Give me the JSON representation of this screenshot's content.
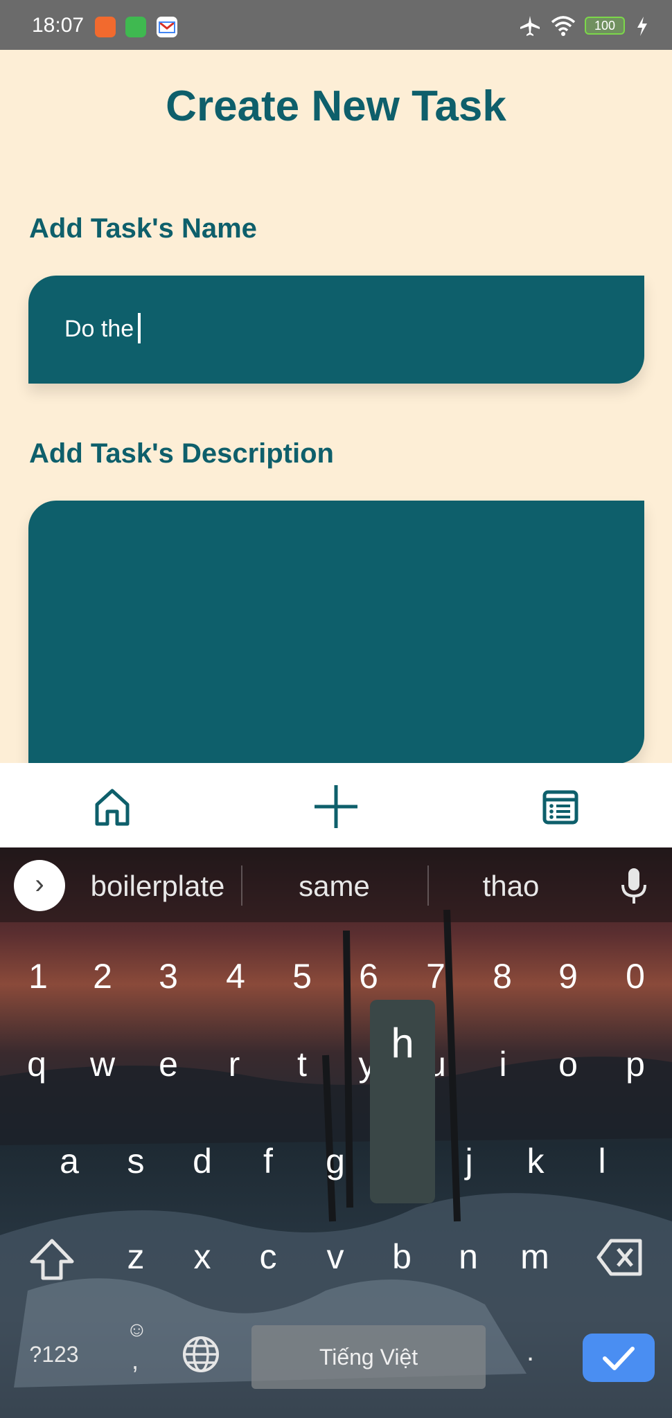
{
  "status_bar": {
    "time": "18:07",
    "battery": "100",
    "icons": [
      "video-app-icon",
      "chat-app-icon",
      "gmail-icon",
      "airplane-mode-icon",
      "wifi-icon",
      "battery-icon",
      "charging-icon"
    ]
  },
  "screen": {
    "title": "Create New Task",
    "name_label": "Add Task's Name",
    "name_value": "Do the",
    "description_label": "Add Task's Description",
    "description_value": ""
  },
  "bottom_nav": {
    "items": [
      "home-icon",
      "add-icon",
      "task-list-icon"
    ]
  },
  "keyboard": {
    "suggestions": [
      "boilerplate",
      "same",
      "thao"
    ],
    "number_row": [
      "1",
      "2",
      "3",
      "4",
      "5",
      "6",
      "7",
      "8",
      "9",
      "0"
    ],
    "row1": [
      "q",
      "w",
      "e",
      "r",
      "t",
      "y",
      "u",
      "i",
      "o",
      "p"
    ],
    "row2": [
      "a",
      "s",
      "d",
      "f",
      "g",
      "h",
      "j",
      "k",
      "l"
    ],
    "row3": [
      "z",
      "x",
      "c",
      "v",
      "b",
      "n",
      "m"
    ],
    "pressed_key": "h",
    "symbols_label": "?123",
    "emoji_label": "☺",
    "comma_label": ",",
    "space_label": "Tiếng Việt",
    "period_label": "."
  },
  "colors": {
    "background": "#fdeed6",
    "primary": "#0e5f6b",
    "enter_key": "#4a8ef2"
  }
}
